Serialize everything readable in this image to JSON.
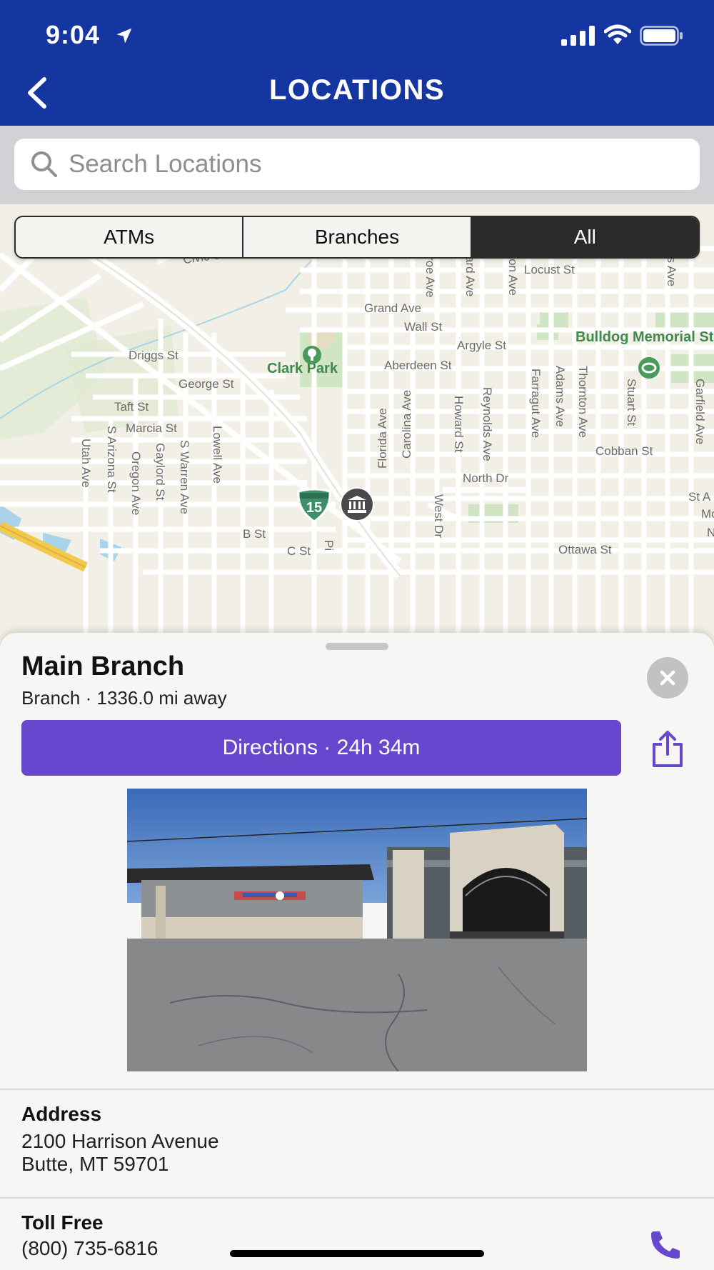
{
  "status_bar": {
    "time": "9:04"
  },
  "header": {
    "title": "LOCATIONS"
  },
  "search": {
    "placeholder": "Search Locations"
  },
  "filter": {
    "segments": [
      "ATMs",
      "Branches",
      "All"
    ],
    "selected": "All"
  },
  "map": {
    "streets": [
      "Civic Center Rd",
      "Grand Ave",
      "Wall St",
      "Locust St",
      "Argyle St",
      "Aberdeen St",
      "Driggs St",
      "George St",
      "Taft St",
      "Marcia St",
      "Cobban St",
      "North Dr",
      "B St",
      "C St",
      "Ottawa St",
      "St A",
      "Mo",
      "N",
      "Monroe Ave",
      "Howard Ave",
      "Wilson Ave",
      "Hayes Ave",
      "Farragut Ave",
      "Adams Ave",
      "Thornton Ave",
      "Stuart St",
      "Garfield Ave",
      "Florida Ave",
      "Carolina Ave",
      "Howard St",
      "Reynolds Ave",
      "West Dr",
      "Utah Ave",
      "S Arizona St",
      "Oregon Ave",
      "Gaylord St",
      "S Warren Ave",
      "Lowell Ave",
      "Pi"
    ],
    "places": [
      "Clark Park",
      "Bulldog Memorial Stadium"
    ],
    "highway_shield": "15"
  },
  "place": {
    "name": "Main Branch",
    "subtitle": "Branch · 1336.0 mi away",
    "directions_label": "Directions · 24h 34m",
    "address_label": "Address",
    "address_line1": "2100 Harrison Avenue",
    "address_line2": "Butte, MT 59701",
    "tollfree_label": "Toll Free",
    "tollfree_number": "(800) 735-6816"
  },
  "colors": {
    "header_bg": "#1535a1",
    "directions_bg": "#6647cd",
    "icon_accent": "#6647cd"
  },
  "icons": [
    "location-arrow-icon",
    "signal-icon",
    "wifi-icon",
    "battery-icon",
    "back-chevron-icon",
    "search-icon",
    "bank-icon",
    "close-icon",
    "share-icon",
    "phone-icon"
  ]
}
